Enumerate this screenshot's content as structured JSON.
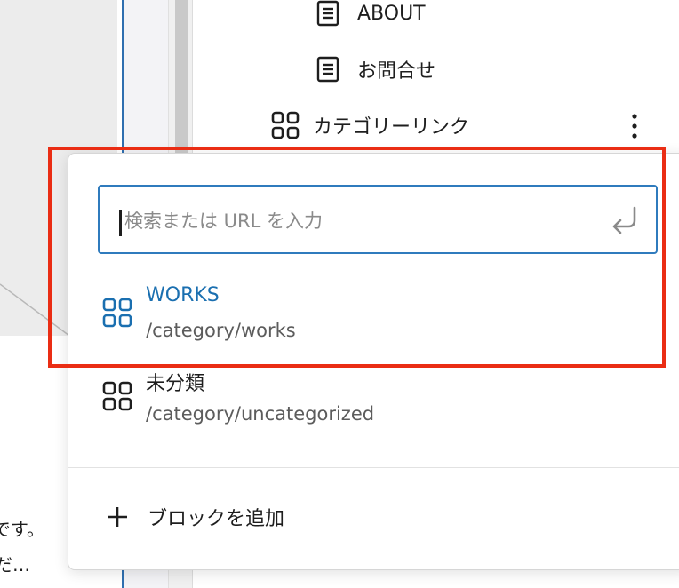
{
  "editor": {
    "behind_line_1": "です。",
    "behind_line_2": "だ…"
  },
  "list_view": {
    "items": [
      {
        "label": "ABOUT",
        "icon": "page-icon"
      },
      {
        "label": "お問合せ",
        "icon": "page-icon"
      },
      {
        "label": "カテゴリーリンク",
        "icon": "category-icon"
      }
    ],
    "options_icon": "kebab-menu-icon"
  },
  "link_popover": {
    "search": {
      "value": "",
      "placeholder": "検索または URL を入力",
      "submit_icon": "enter-icon"
    },
    "suggestions": [
      {
        "title": "WORKS",
        "url": "/category/works",
        "selected": true,
        "icon": "category-icon"
      },
      {
        "title": "未分類",
        "url": "/category/uncategorized",
        "selected": false,
        "icon": "category-icon"
      }
    ],
    "add_block_label": "ブロックを追加",
    "add_block_icon": "plus-icon"
  },
  "colors": {
    "accent": "#2f7bbd",
    "selected_text": "#1a6fb0",
    "annotation": "#ea2d14"
  }
}
